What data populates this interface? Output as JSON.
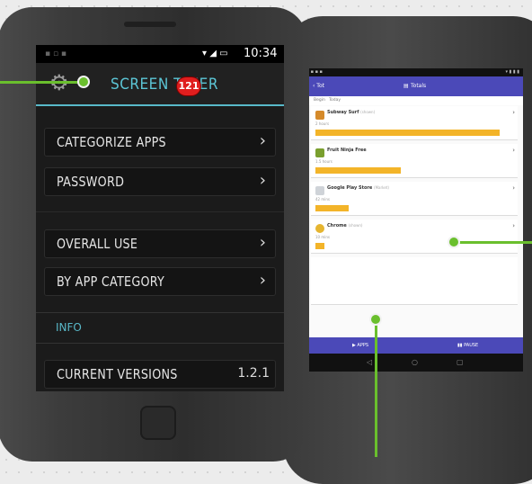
{
  "phone_front": {
    "status_time": "10:34",
    "app_title": "SCREEN TIMER",
    "menu": [
      {
        "label": "CATEGORIZE APPS",
        "chevron": "›",
        "badge": "121"
      },
      {
        "label": "PASSWORD",
        "chevron": "›"
      },
      {
        "label": "OVERALL USE",
        "chevron": "›"
      },
      {
        "label": "BY APP CATEGORY",
        "chevron": "›"
      }
    ],
    "section_info": "INFO",
    "current_versions_label": "CURRENT VERSIONS",
    "current_versions_value": "1.2.1"
  },
  "phone_back": {
    "appbar_title": "Totals",
    "back_label": "‹ Tot",
    "tabs": [
      "Begin",
      "Today"
    ],
    "apps": [
      {
        "name": "Subway Surf",
        "note": "(shown)",
        "sub": "2 hours",
        "usage": 0.93,
        "color": "#d58a2a"
      },
      {
        "name": "Fruit Ninja Free",
        "note": "",
        "sub": "1.5 hours",
        "usage": 0.44,
        "color": "#7a9f2e"
      },
      {
        "name": "Google Play Store",
        "note": "(Market)",
        "sub": "42 mins",
        "usage": 0.17,
        "color": "#cfd3d8"
      },
      {
        "name": "Chrome",
        "note": "(shown)",
        "sub": "10 mins",
        "usage": 0.05,
        "color": "#e6b530"
      }
    ],
    "bottom_buttons": [
      "▶ APPS",
      "▮▮ PAUSE"
    ],
    "nav_icons": [
      "◁",
      "○",
      "▢"
    ]
  },
  "colors": {
    "accent": "#5cc6d6",
    "badge": "#e01e1e",
    "callout": "#6abf2d",
    "appbar": "#4b49b8",
    "bar": "#f3b429"
  }
}
